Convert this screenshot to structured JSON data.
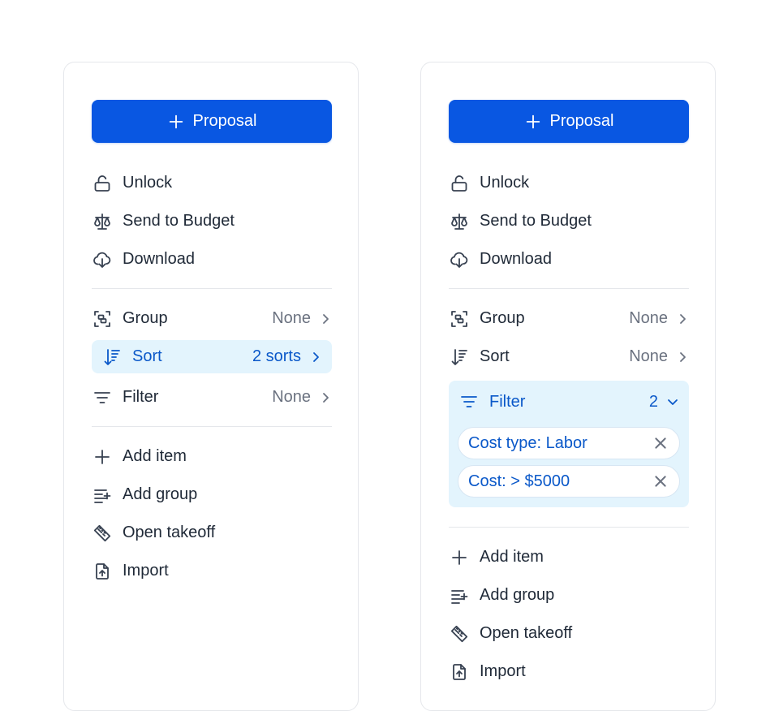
{
  "left_panel": {
    "proposal_label": "Proposal",
    "actions": [
      {
        "label": "Unlock",
        "icon": "unlock-icon"
      },
      {
        "label": "Send to Budget",
        "icon": "scale-icon"
      },
      {
        "label": "Download",
        "icon": "cloud-download-icon"
      }
    ],
    "view": {
      "group": {
        "label": "Group",
        "value": "None"
      },
      "sort": {
        "label": "Sort",
        "value": "2 sorts",
        "active": true
      },
      "filter": {
        "label": "Filter",
        "value": "None"
      }
    },
    "add": [
      {
        "label": "Add item",
        "icon": "plus-icon"
      },
      {
        "label": "Add group",
        "icon": "add-group-icon"
      },
      {
        "label": "Open takeoff",
        "icon": "ruler-icon"
      },
      {
        "label": "Import",
        "icon": "file-upload-icon"
      }
    ]
  },
  "right_panel": {
    "proposal_label": "Proposal",
    "actions": [
      {
        "label": "Unlock",
        "icon": "unlock-icon"
      },
      {
        "label": "Send to Budget",
        "icon": "scale-icon"
      },
      {
        "label": "Download",
        "icon": "cloud-download-icon"
      }
    ],
    "view": {
      "group": {
        "label": "Group",
        "value": "None"
      },
      "sort": {
        "label": "Sort",
        "value": "None"
      },
      "filter": {
        "label": "Filter",
        "count": "2",
        "expanded": true,
        "chips": [
          {
            "field": "Cost type:",
            "value": "Labor"
          },
          {
            "field": "Cost:",
            "value": "> $5000"
          }
        ]
      }
    },
    "add": [
      {
        "label": "Add item",
        "icon": "plus-icon"
      },
      {
        "label": "Add group",
        "icon": "add-group-icon"
      },
      {
        "label": "Open takeoff",
        "icon": "ruler-icon"
      },
      {
        "label": "Import",
        "icon": "file-upload-icon"
      }
    ]
  },
  "colors": {
    "primary": "#0957e2",
    "active_bg": "#e3f4fd",
    "active_text": "#0a58c9",
    "muted": "#6b7280",
    "border": "#e5e7eb"
  }
}
